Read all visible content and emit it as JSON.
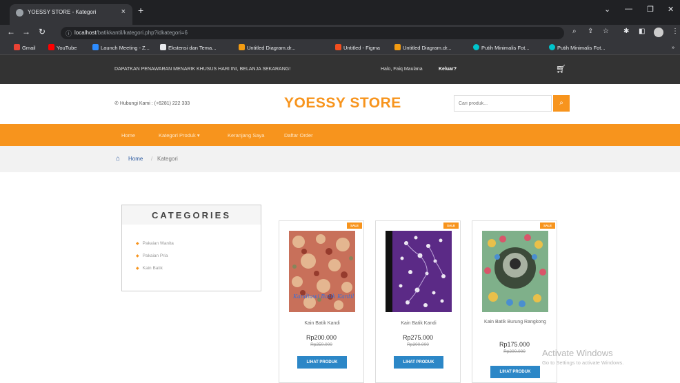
{
  "browser": {
    "tab_title": "YOESSY STORE - Kategori",
    "url_host": "localhost",
    "url_path": "/batikkantil/kategori.php?idkategori=6",
    "bookmarks": [
      "Gmail",
      "YouTube",
      "Launch Meeting - Z...",
      "Ekstensi dan Tema...",
      "Untitled Diagram.dr...",
      "Untitled - Figma",
      "Untitled Diagram.dr...",
      "Putih Minimalis Fot...",
      "Putih Minimalis Fot..."
    ]
  },
  "topbar": {
    "promo": "DAPATKAN PENAWARAN MENARIK KHUSUS HARI INI, BELANJA SEKARANG!",
    "greeting": "Halo, Faiq Maulana",
    "logout": "Keluar?"
  },
  "header": {
    "contact": "Hubungi Kami : (+6281) 222 333",
    "brand": "YOESSY STORE",
    "search_placeholder": "Cari produk..."
  },
  "nav": {
    "items": [
      "Home",
      "Kategori Produk ▾",
      "Keranjang Saya",
      "Daftar Order"
    ]
  },
  "breadcrumb": {
    "home": "Home",
    "separator": "/",
    "current": "Kategori"
  },
  "sidebar": {
    "heading": "CATEGORIES",
    "items": [
      "Pakaian Wanita",
      "Pakaian Pria",
      "Kain Batik"
    ]
  },
  "products": [
    {
      "badge": "SALE",
      "name": "Kain Batik Kandi",
      "price": "Rp200.000",
      "old_price": "Rp250.000",
      "button": "LIHAT PRODUK",
      "image_caption": "Kandiawi Batik Kantil"
    },
    {
      "badge": "SALE",
      "name": "Kain Batik Kandi",
      "price": "Rp275.000",
      "old_price": "Rp300.000",
      "button": "LIHAT PRODUK"
    },
    {
      "badge": "SALE",
      "name": "Kain Batik Burung Rangkong",
      "price": "Rp175.000",
      "old_price": "Rp200.000",
      "button": "LIHAT PRODUK"
    }
  ],
  "watermark": {
    "title": "Activate Windows",
    "subtitle": "Go to Settings to activate Windows."
  },
  "colors": {
    "accent": "#f7941d",
    "button": "#2c87c7",
    "topbar": "#333333"
  }
}
